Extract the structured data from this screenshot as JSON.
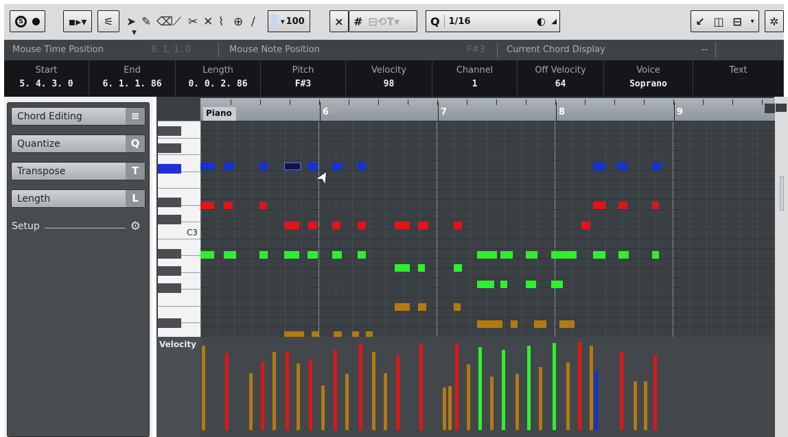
{
  "toolbar": {
    "solo_label": "S",
    "quantize_label": "Q",
    "quantize_value": "1/16",
    "velocity_value": "100",
    "inspector_labels": [
      "Chord Editing",
      "Quantize",
      "Transpose",
      "Length"
    ],
    "tools": [
      "object-selection-tool",
      "draw-tool",
      "erase-tool",
      "trim-tool",
      "split-tool",
      "mute-tool",
      "glue-tool",
      "zoom-tool",
      "line-tool"
    ]
  },
  "infoline": {
    "mouse_time_label": "Mouse Time Position",
    "mouse_time_value": "6. 1. 1. 0",
    "mouse_note_label": "Mouse Note Position",
    "mouse_note_value": "F#3",
    "chord_label": "Current Chord Display",
    "chord_value": "--"
  },
  "noteinfo": [
    {
      "label": "Start",
      "value": "5. 4. 3. 0"
    },
    {
      "label": "End",
      "value": "6. 1. 1. 86"
    },
    {
      "label": "Length",
      "value": "0. 0. 2. 86"
    },
    {
      "label": "Pitch",
      "value": "F#3"
    },
    {
      "label": "Velocity",
      "value": "98"
    },
    {
      "label": "Channel",
      "value": "1"
    },
    {
      "label": "Off Velocity",
      "value": "64"
    },
    {
      "label": "Voice",
      "value": "Soprano"
    },
    {
      "label": "Text",
      "value": ""
    }
  ],
  "left_zone": {
    "sections": [
      {
        "label": "Chord Editing",
        "icon": "chord-icon",
        "icon_glyph": "≡"
      },
      {
        "label": "Quantize",
        "icon": "quantize-icon",
        "icon_glyph": "Q"
      },
      {
        "label": "Transpose",
        "icon": "transpose-icon",
        "icon_glyph": "T"
      },
      {
        "label": "Length",
        "icon": "length-icon",
        "icon_glyph": "L"
      }
    ],
    "setup_label": "Setup"
  },
  "editor": {
    "part_name": "Piano",
    "bars": [
      "6",
      "7",
      "8",
      "9"
    ],
    "c3_label": "C3",
    "velocity_label": "Velocity"
  },
  "colors": {
    "blue": "#1232d8",
    "red": "#e01616",
    "green": "#2cf22c",
    "orange": "#b47a10",
    "selected": "#10144a"
  },
  "notes": [
    {
      "color": "blue",
      "row": 0,
      "start": 0,
      "len": 0.8
    },
    {
      "color": "blue",
      "row": 0,
      "start": 1.4,
      "len": 0.6
    },
    {
      "color": "blue",
      "row": 0,
      "start": 3.5,
      "len": 0.5
    },
    {
      "color": "selected",
      "row": 0,
      "start": 4.95,
      "len": 1.0
    },
    {
      "color": "blue",
      "row": 0,
      "start": 6.35,
      "len": 0.6
    },
    {
      "color": "blue",
      "row": 0,
      "start": 7.8,
      "len": 0.6
    },
    {
      "color": "blue",
      "row": 0,
      "start": 9.3,
      "len": 0.5
    },
    {
      "color": "blue",
      "row": 0,
      "start": 23.3,
      "len": 0.7
    },
    {
      "color": "blue",
      "row": 0,
      "start": 24.7,
      "len": 0.6
    },
    {
      "color": "blue",
      "row": 0,
      "start": 26.8,
      "len": 0.5
    },
    {
      "color": "red",
      "row": 1.4,
      "start": 0,
      "len": 0.8
    },
    {
      "color": "red",
      "row": 1.4,
      "start": 1.4,
      "len": 0.5
    },
    {
      "color": "red",
      "row": 1.4,
      "start": 3.5,
      "len": 0.4
    },
    {
      "color": "red",
      "row": 1.4,
      "start": 23.3,
      "len": 0.7
    },
    {
      "color": "red",
      "row": 1.4,
      "start": 24.8,
      "len": 0.5
    },
    {
      "color": "red",
      "row": 1.4,
      "start": 26.8,
      "len": 0.4
    },
    {
      "color": "red",
      "row": 2.1,
      "start": 4.95,
      "len": 0.9
    },
    {
      "color": "red",
      "row": 2.1,
      "start": 6.4,
      "len": 0.5
    },
    {
      "color": "red",
      "row": 2.1,
      "start": 7.8,
      "len": 0.5
    },
    {
      "color": "red",
      "row": 2.1,
      "start": 9.3,
      "len": 0.5
    },
    {
      "color": "red",
      "row": 2.1,
      "start": 11.5,
      "len": 0.9
    },
    {
      "color": "red",
      "row": 2.1,
      "start": 12.9,
      "len": 0.6
    },
    {
      "color": "red",
      "row": 2.1,
      "start": 15.0,
      "len": 0.5
    },
    {
      "color": "red",
      "row": 2.1,
      "start": 22.6,
      "len": 0.5
    },
    {
      "color": "green",
      "row": 3.15,
      "start": 0,
      "len": 0.8
    },
    {
      "color": "green",
      "row": 3.15,
      "start": 1.4,
      "len": 0.7
    },
    {
      "color": "green",
      "row": 3.15,
      "start": 3.5,
      "len": 0.5
    },
    {
      "color": "green",
      "row": 3.15,
      "start": 4.95,
      "len": 0.9
    },
    {
      "color": "green",
      "row": 3.15,
      "start": 6.35,
      "len": 0.6
    },
    {
      "color": "green",
      "row": 3.15,
      "start": 7.8,
      "len": 0.6
    },
    {
      "color": "green",
      "row": 3.15,
      "start": 9.3,
      "len": 0.5
    },
    {
      "color": "green",
      "row": 3.15,
      "start": 16.4,
      "len": 1.2
    },
    {
      "color": "green",
      "row": 3.15,
      "start": 17.8,
      "len": 0.7
    },
    {
      "color": "green",
      "row": 3.15,
      "start": 19.3,
      "len": 0.7
    },
    {
      "color": "green",
      "row": 3.15,
      "start": 20.8,
      "len": 1.5
    },
    {
      "color": "green",
      "row": 3.15,
      "start": 23.3,
      "len": 0.7
    },
    {
      "color": "green",
      "row": 3.15,
      "start": 24.8,
      "len": 0.6
    },
    {
      "color": "green",
      "row": 3.15,
      "start": 26.8,
      "len": 0.4
    },
    {
      "color": "green",
      "row": 3.6,
      "start": 11.5,
      "len": 0.9
    },
    {
      "color": "green",
      "row": 3.6,
      "start": 12.9,
      "len": 0.4
    },
    {
      "color": "green",
      "row": 3.6,
      "start": 15.0,
      "len": 0.5
    },
    {
      "color": "green",
      "row": 4.2,
      "start": 16.4,
      "len": 1.0
    },
    {
      "color": "green",
      "row": 4.2,
      "start": 17.8,
      "len": 0.4
    },
    {
      "color": "green",
      "row": 4.2,
      "start": 19.3,
      "len": 0.6
    },
    {
      "color": "green",
      "row": 4.2,
      "start": 20.8,
      "len": 0.7
    },
    {
      "color": "orange",
      "row": 5.0,
      "start": 11.5,
      "len": 0.9
    },
    {
      "color": "orange",
      "row": 5.0,
      "start": 12.9,
      "len": 0.5
    },
    {
      "color": "orange",
      "row": 5.0,
      "start": 15.0,
      "len": 0.4
    },
    {
      "color": "orange",
      "row": 5.6,
      "start": 16.4,
      "len": 1.5
    },
    {
      "color": "orange",
      "row": 5.6,
      "start": 18.4,
      "len": 0.4
    },
    {
      "color": "orange",
      "row": 5.6,
      "start": 19.8,
      "len": 0.7
    },
    {
      "color": "orange",
      "row": 5.6,
      "start": 21.3,
      "len": 0.9
    },
    {
      "color": "orange",
      "row": 6.0,
      "start": 4.95,
      "len": 1.2
    },
    {
      "color": "orange",
      "row": 6.0,
      "start": 6.6,
      "len": 0.4
    },
    {
      "color": "orange",
      "row": 6.0,
      "start": 7.9,
      "len": 0.5
    },
    {
      "color": "orange",
      "row": 6.0,
      "start": 9.0,
      "len": 0.4
    },
    {
      "color": "orange",
      "row": 6.0,
      "start": 9.8,
      "len": 0.3
    }
  ],
  "velocities": [
    {
      "color": "orange",
      "start": 0,
      "value": 0.95
    },
    {
      "color": "blue",
      "start": 1.4,
      "value": 0.82
    },
    {
      "color": "red",
      "start": 1.4,
      "value": 0.86
    },
    {
      "color": "orange",
      "start": 2.8,
      "value": 0.64
    },
    {
      "color": "green",
      "start": 3.5,
      "value": 0.72
    },
    {
      "color": "red",
      "start": 3.5,
      "value": 0.77
    },
    {
      "color": "orange",
      "start": 4.2,
      "value": 0.88
    },
    {
      "color": "selected",
      "start": 4.95,
      "value": 0.82
    },
    {
      "color": "red",
      "start": 4.95,
      "value": 0.88
    },
    {
      "color": "orange",
      "start": 5.6,
      "value": 0.75
    },
    {
      "color": "blue",
      "start": 6.35,
      "value": 0.73
    },
    {
      "color": "red",
      "start": 6.35,
      "value": 0.8
    },
    {
      "color": "orange",
      "start": 7.1,
      "value": 0.5
    },
    {
      "color": "blue",
      "start": 7.8,
      "value": 0.71
    },
    {
      "color": "red",
      "start": 7.8,
      "value": 0.9
    },
    {
      "color": "orange",
      "start": 8.5,
      "value": 0.63
    },
    {
      "color": "red",
      "start": 9.3,
      "value": 0.97
    },
    {
      "color": "orange",
      "start": 10.1,
      "value": 0.88
    },
    {
      "color": "orange",
      "start": 10.8,
      "value": 0.64
    },
    {
      "color": "green",
      "start": 11.5,
      "value": 0.75
    },
    {
      "color": "red",
      "start": 11.5,
      "value": 0.84
    },
    {
      "color": "red",
      "start": 12.9,
      "value": 0.97
    },
    {
      "color": "orange",
      "start": 14.3,
      "value": 0.48
    },
    {
      "color": "orange",
      "start": 14.6,
      "value": 0.49
    },
    {
      "color": "red",
      "start": 15.0,
      "value": 0.97
    },
    {
      "color": "orange",
      "start": 15.7,
      "value": 0.74
    },
    {
      "color": "green",
      "start": 16.4,
      "value": 0.93
    },
    {
      "color": "orange",
      "start": 17.1,
      "value": 0.6
    },
    {
      "color": "green",
      "start": 17.8,
      "value": 0.9
    },
    {
      "color": "orange",
      "start": 18.6,
      "value": 0.63
    },
    {
      "color": "green",
      "start": 19.3,
      "value": 0.95
    },
    {
      "color": "orange",
      "start": 20.0,
      "value": 0.71
    },
    {
      "color": "green",
      "start": 20.8,
      "value": 0.98
    },
    {
      "color": "orange",
      "start": 21.6,
      "value": 0.76
    },
    {
      "color": "red",
      "start": 22.3,
      "value": 0.99
    },
    {
      "color": "orange",
      "start": 23.0,
      "value": 0.95
    },
    {
      "color": "blue",
      "start": 23.3,
      "value": 0.66
    },
    {
      "color": "red",
      "start": 24.8,
      "value": 0.88
    },
    {
      "color": "orange",
      "start": 25.6,
      "value": 0.55
    },
    {
      "color": "red",
      "start": 26.8,
      "value": 0.84
    },
    {
      "color": "orange",
      "start": 26.2,
      "value": 0.55
    }
  ]
}
